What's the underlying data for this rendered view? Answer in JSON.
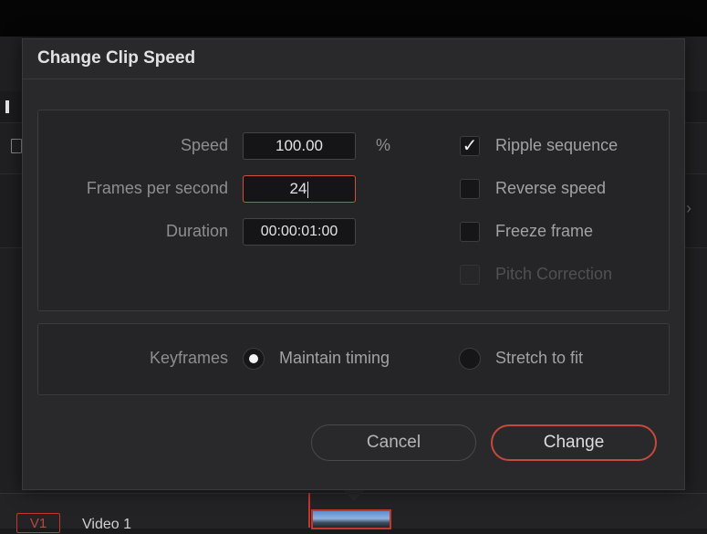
{
  "dialog": {
    "title": "Change Clip Speed",
    "fields": {
      "speed_label": "Speed",
      "speed_value": "100.00",
      "speed_unit": "%",
      "fps_label": "Frames per second",
      "fps_value": "24",
      "duration_label": "Duration",
      "duration_value": "00:00:01:00"
    },
    "options": {
      "ripple_sequence": {
        "label": "Ripple sequence",
        "checked": true
      },
      "reverse_speed": {
        "label": "Reverse speed",
        "checked": false
      },
      "freeze_frame": {
        "label": "Freeze frame",
        "checked": false
      },
      "pitch_correction": {
        "label": "Pitch Correction",
        "checked": false,
        "disabled": true
      }
    },
    "keyframes": {
      "label": "Keyframes",
      "maintain_timing": {
        "label": "Maintain timing",
        "selected": true
      },
      "stretch_to_fit": {
        "label": "Stretch to fit",
        "selected": false
      }
    },
    "buttons": {
      "cancel": "Cancel",
      "change": "Change"
    }
  },
  "timeline": {
    "track_id": "V1",
    "track_name": "Video 1"
  },
  "colors": {
    "accent": "#c44a3b",
    "dialog_bg": "#29292b",
    "panel_bg": "#252527"
  }
}
